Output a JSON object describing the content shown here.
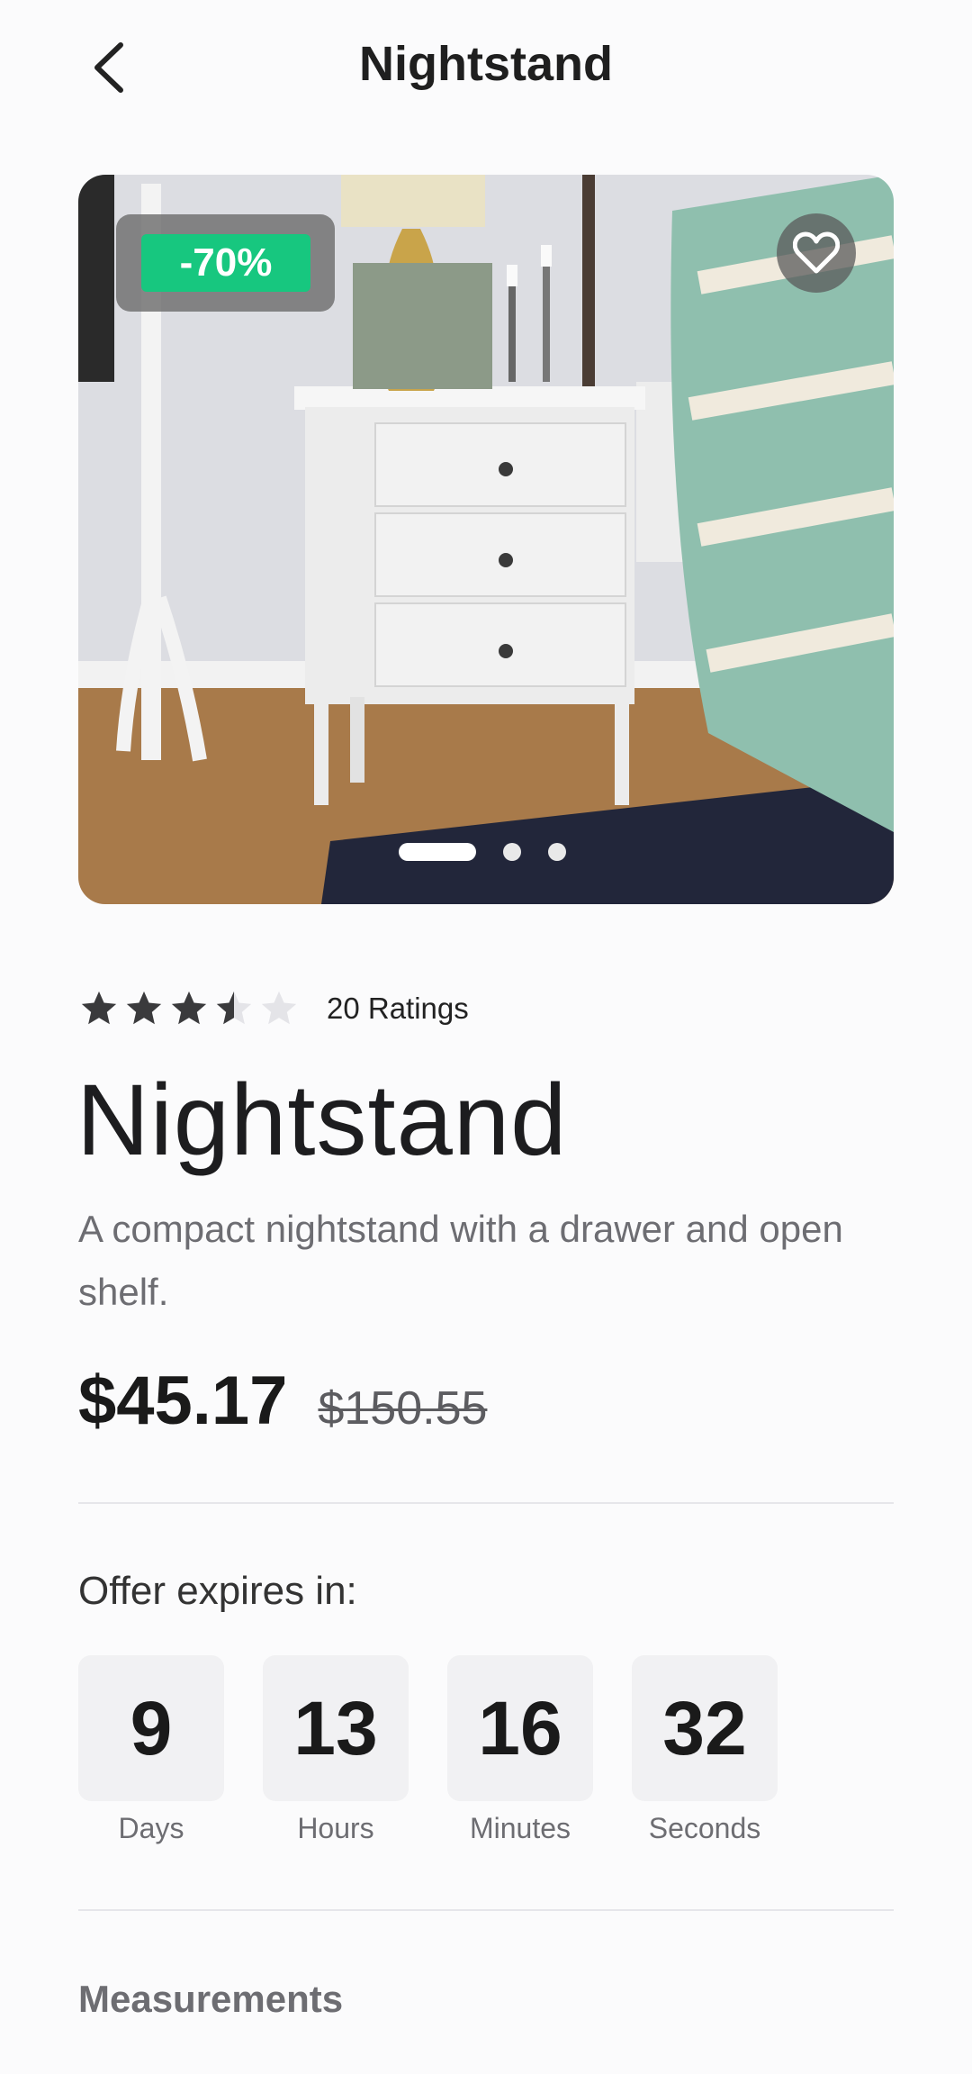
{
  "header": {
    "title": "Nightstand",
    "back_icon": "chevron-left-icon"
  },
  "hero": {
    "discount_badge": "-70%",
    "favorite_icon": "heart-icon",
    "carousel": {
      "total": 3,
      "active": 1
    }
  },
  "product": {
    "rating_value": 3.5,
    "rating_max": 5,
    "ratings_label": "20 Ratings",
    "title": "Nightstand",
    "description": "A compact nightstand with a drawer and open shelf.",
    "price": "$45.17",
    "original_price": "$150.55"
  },
  "offer": {
    "label": "Offer expires in:",
    "countdown": [
      {
        "value": "9",
        "unit": "Days"
      },
      {
        "value": "13",
        "unit": "Hours"
      },
      {
        "value": "16",
        "unit": "Minutes"
      },
      {
        "value": "32",
        "unit": "Seconds"
      }
    ]
  },
  "sections": {
    "measurements_title": "Measurements"
  },
  "colors": {
    "badge": "#17c77f",
    "star_filled": "#3a3a3c",
    "star_empty": "#e4e4e8"
  }
}
